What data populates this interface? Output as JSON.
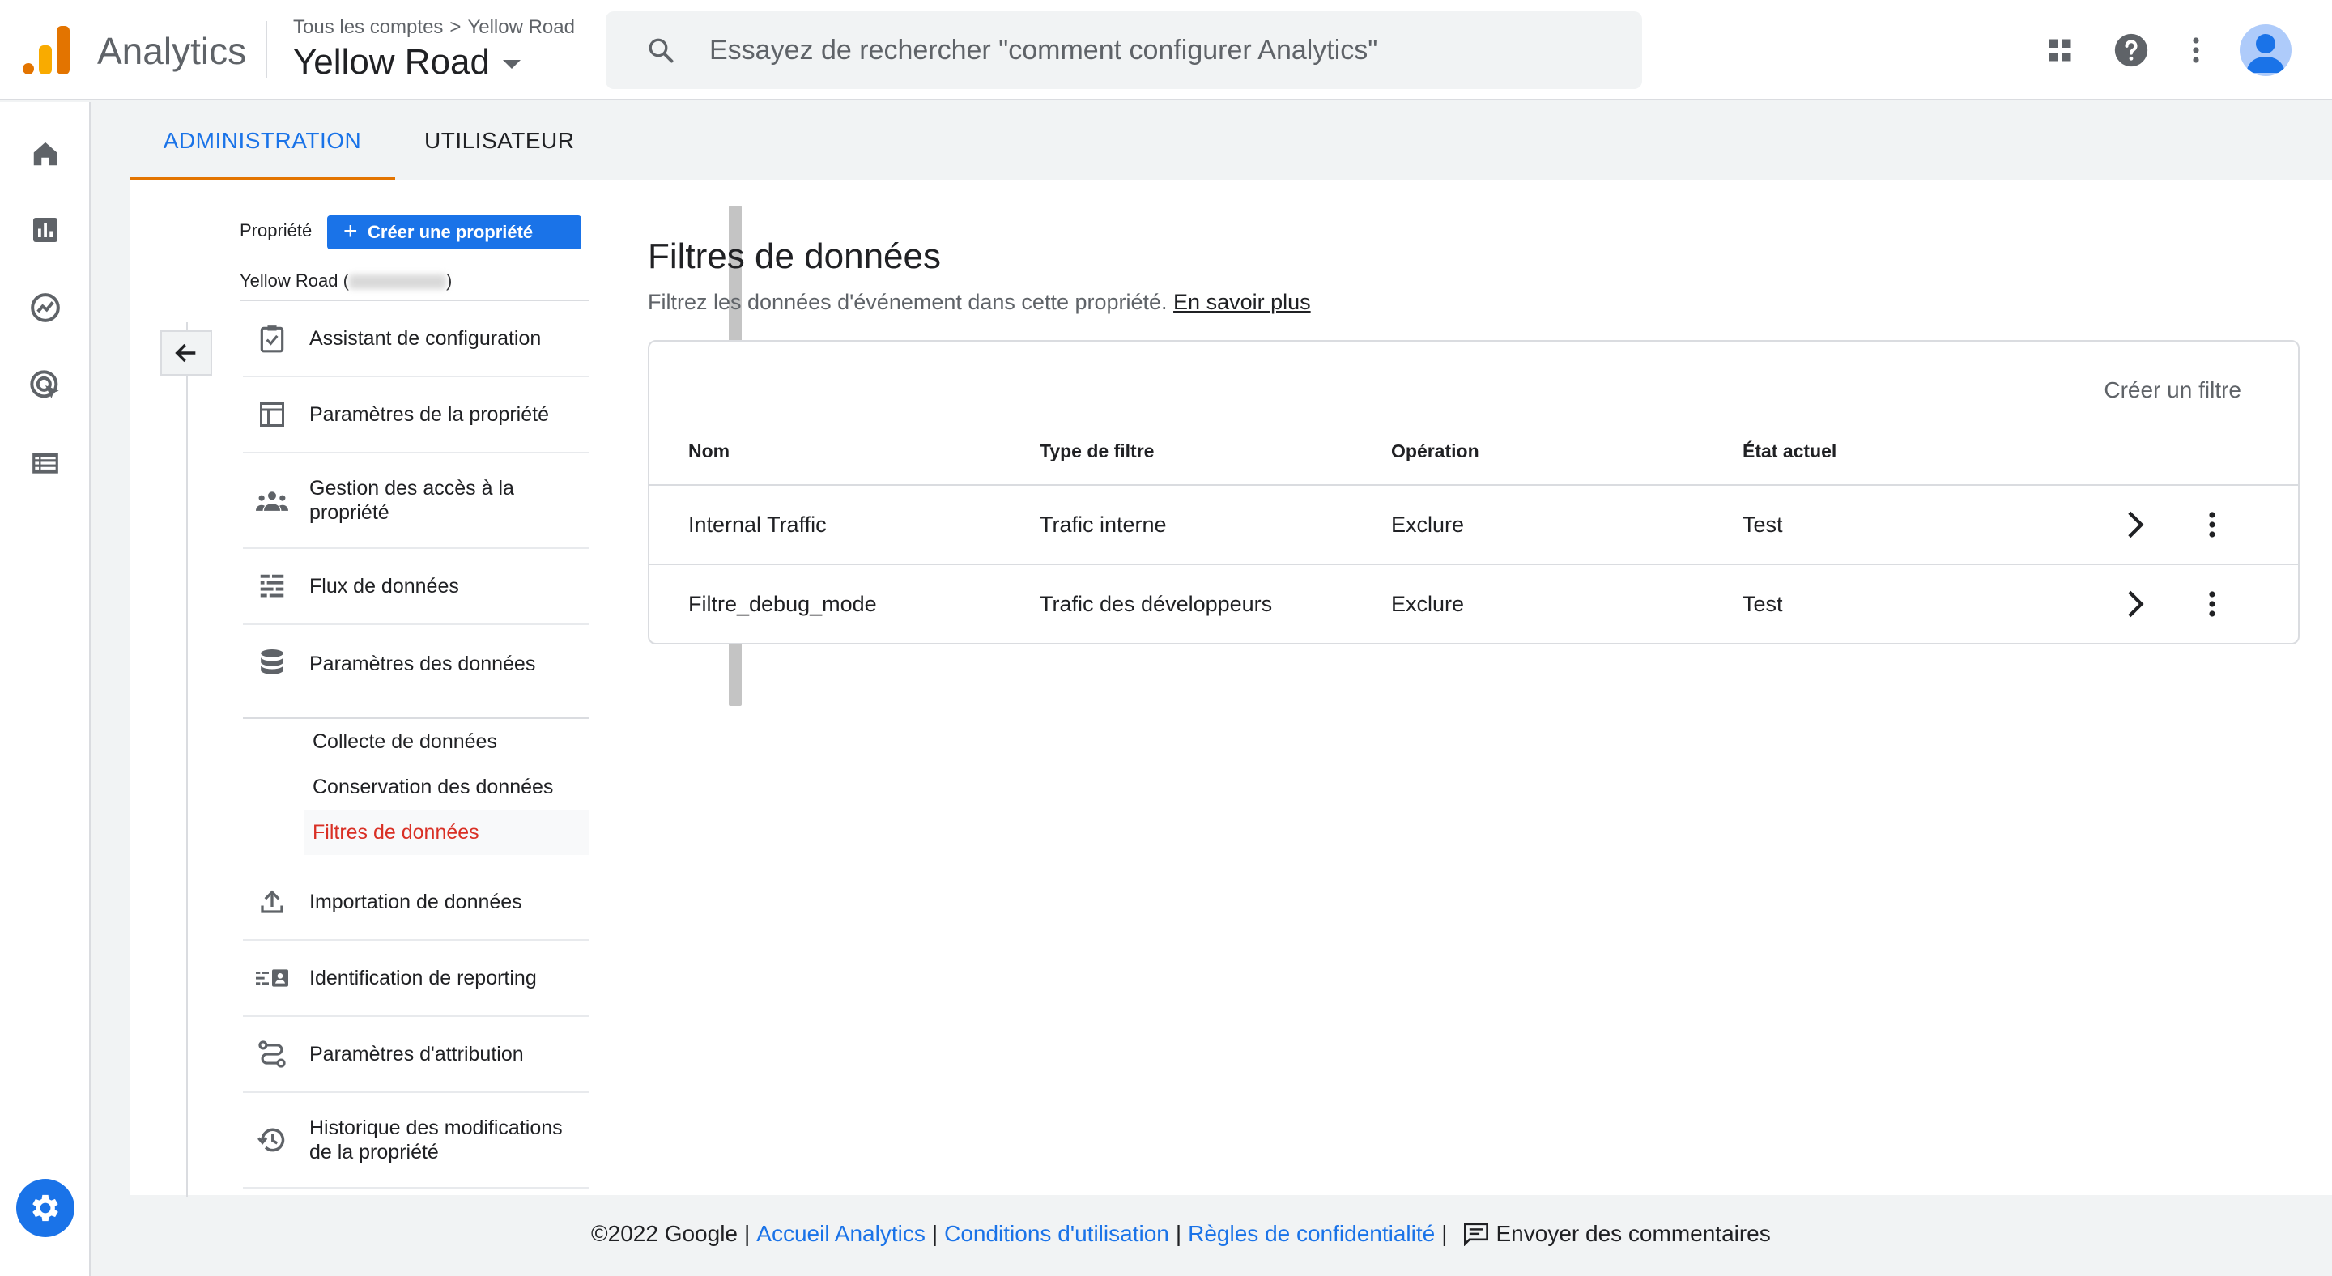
{
  "header": {
    "app_name": "Analytics",
    "breadcrumb_root": "Tous les comptes",
    "breadcrumb_sep": ">",
    "breadcrumb_account": "Yellow Road",
    "property_name": "Yellow Road",
    "search_placeholder": "Essayez de rechercher \"comment configurer Analytics\""
  },
  "tabs": {
    "admin": "ADMINISTRATION",
    "user": "UTILISATEUR"
  },
  "property": {
    "label": "Propriété",
    "create_button": "Créer une propriété",
    "name_prefix": "Yellow Road (",
    "name_suffix": ")"
  },
  "nav": {
    "setup_assistant": "Assistant de configuration",
    "property_settings": "Paramètres de la propriété",
    "access_management": "Gestion des accès à la propriété",
    "data_streams": "Flux de données",
    "data_settings": "Paramètres des données",
    "data_collection": "Collecte de données",
    "data_retention": "Conservation des données",
    "data_filters": "Filtres de données",
    "data_import": "Importation de données",
    "reporting_identity": "Identification de reporting",
    "attribution_settings": "Paramètres d'attribution",
    "change_history": "Historique des modifications de la propriété"
  },
  "content": {
    "title": "Filtres de données",
    "subtitle": "Filtrez les données d'événement dans cette propriété.",
    "learn_more": "En savoir plus",
    "create_filter": "Créer un filtre",
    "columns": {
      "name": "Nom",
      "type": "Type de filtre",
      "operation": "Opération",
      "state": "État actuel"
    },
    "rows": [
      {
        "name": "Internal Traffic",
        "type": "Trafic interne",
        "operation": "Exclure",
        "state": "Test"
      },
      {
        "name": "Filtre_debug_mode",
        "type": "Trafic des développeurs",
        "operation": "Exclure",
        "state": "Test"
      }
    ]
  },
  "footer": {
    "copyright": "©2022 Google",
    "sep": "|",
    "home": "Accueil Analytics",
    "terms": "Conditions d'utilisation",
    "privacy": "Règles de confidentialité",
    "feedback": "Envoyer des commentaires"
  },
  "colors": {
    "accent": "#1a73e8",
    "tab_underline": "#e37400",
    "active_nav": "#d93025"
  }
}
